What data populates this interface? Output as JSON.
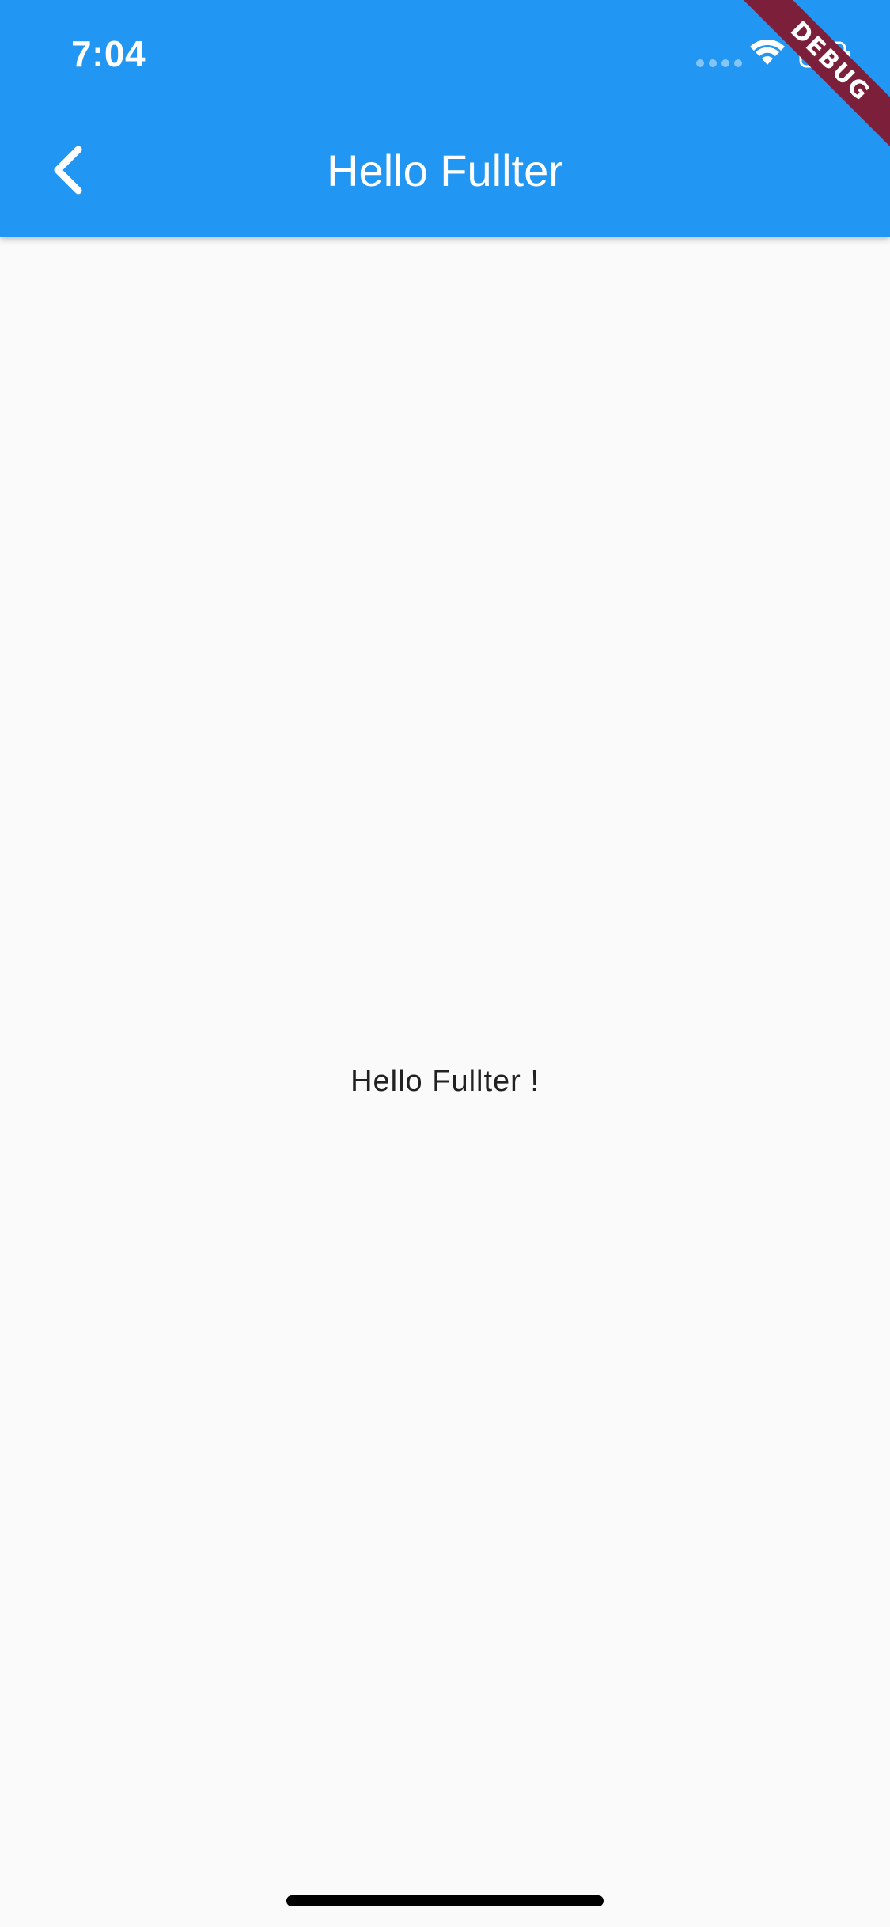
{
  "status_bar": {
    "time": "7:04",
    "icons": [
      "cellular-signal-icon",
      "wifi-icon",
      "battery-icon"
    ]
  },
  "app_bar": {
    "title": "Hello Fullter",
    "back_icon": "chevron-left-icon",
    "background_color": "#2196f3",
    "text_color": "#ffffff"
  },
  "debug_banner": {
    "label": "DEBUG",
    "color": "#7b1f3a"
  },
  "body": {
    "text": "Hello Fullter !",
    "background_color": "#fafafa"
  }
}
